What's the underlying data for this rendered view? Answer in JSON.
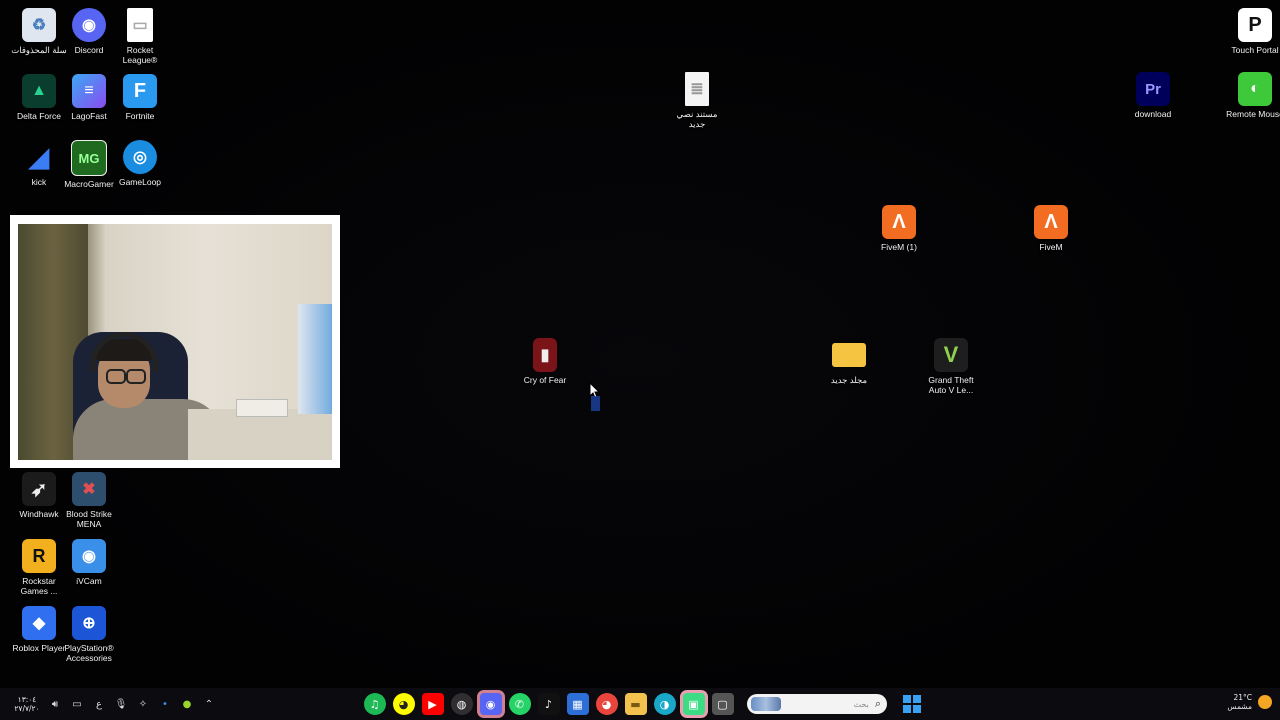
{
  "desktop_icons": [
    {
      "id": "recycle-bin",
      "label": "سلة المحذوفات",
      "color": "#e9eef5"
    },
    {
      "id": "discord",
      "label": "Discord",
      "color": "#5865f2"
    },
    {
      "id": "rocket-league",
      "label": "Rocket League®",
      "color": "#ffffff"
    },
    {
      "id": "touch-portal",
      "label": "Touch Portal",
      "color": "#ffffff"
    },
    {
      "id": "delta-force",
      "label": "Delta Force",
      "color": "#0a7d5a"
    },
    {
      "id": "lagofast",
      "label": "LagoFast",
      "color": "#6a4cf0"
    },
    {
      "id": "fortnite",
      "label": "Fortnite",
      "color": "#2a9af0"
    },
    {
      "id": "new-text-doc",
      "label": "مستند نصي جديد",
      "color": "#f4f4f4"
    },
    {
      "id": "premiere",
      "label": "download",
      "color": "#00005b"
    },
    {
      "id": "remote-mouse",
      "label": "Remote Mouse",
      "color": "#3ec93a"
    },
    {
      "id": "kick",
      "label": "kick",
      "color": "#2a63d6"
    },
    {
      "id": "macrogamer",
      "label": "MacroGamer",
      "color": "#1f6a1f"
    },
    {
      "id": "gameloop",
      "label": "GameLoop",
      "color": "#1a8de0"
    },
    {
      "id": "fivem-1",
      "label": "FiveM (1)",
      "color": "#f26d21"
    },
    {
      "id": "fivem",
      "label": "FiveM",
      "color": "#f26d21"
    },
    {
      "id": "cry-of-fear",
      "label": "Cry of Fear",
      "color": "#7a1418"
    },
    {
      "id": "new-folder",
      "label": "مجلد جديد",
      "color": "#f5c542"
    },
    {
      "id": "gta-v",
      "label": "Grand Theft Auto V Le...",
      "color": "#2f2f2f"
    },
    {
      "id": "windhawk",
      "label": "Windhawk",
      "color": "#1b1b1b"
    },
    {
      "id": "blood-strike",
      "label": "Blood Strike MENA",
      "color": "#2e4e6e"
    },
    {
      "id": "rockstar",
      "label": "Rockstar Games ...",
      "color": "#f2b01e"
    },
    {
      "id": "ivcam",
      "label": "iVCam",
      "color": "#3a8fe8"
    },
    {
      "id": "roblox",
      "label": "Roblox Player",
      "color": "#2f6ff0"
    },
    {
      "id": "ps-accessories",
      "label": "PlayStation® Accessories",
      "color": "#1c56d6"
    }
  ],
  "glyphs": {
    "recycle-bin": "♻",
    "discord": "◉",
    "rocket-league": "▭",
    "touch-portal": "P",
    "delta-force": "▲",
    "lagofast": "≡",
    "fortnite": "F",
    "new-text-doc": "≣",
    "premiere": "Pr",
    "remote-mouse": "◐",
    "kick": "◢",
    "macrogamer": "MG",
    "gameloop": "◎",
    "fivem-1": "Λ",
    "fivem": "Λ",
    "cry-of-fear": "▮",
    "new-folder": "▬",
    "gta-v": "V",
    "windhawk": "➶",
    "blood-strike": "✖",
    "rockstar": "R",
    "ivcam": "◉",
    "roblox": "◆",
    "ps-accessories": "⊕"
  },
  "taskbar": {
    "search_placeholder": "بحث",
    "apps": [
      {
        "id": "spotify",
        "glyph": "♫",
        "color": "#1db954"
      },
      {
        "id": "snapchat",
        "glyph": "◕",
        "color": "#fffc00"
      },
      {
        "id": "youtube",
        "glyph": "▶",
        "color": "#ff0000"
      },
      {
        "id": "obs",
        "glyph": "◍",
        "color": "#302e31"
      },
      {
        "id": "discord",
        "glyph": "◉",
        "color": "#5865f2"
      },
      {
        "id": "whatsapp",
        "glyph": "✆",
        "color": "#25d366"
      },
      {
        "id": "tiktok",
        "glyph": "♪",
        "color": "#111111"
      },
      {
        "id": "store",
        "glyph": "▦",
        "color": "#2d6fd6"
      },
      {
        "id": "chrome",
        "glyph": "◕",
        "color": "#e8453c"
      },
      {
        "id": "file-explorer",
        "glyph": "▬",
        "color": "#f2c14e"
      },
      {
        "id": "edge",
        "glyph": "◑",
        "color": "#1aa8c9"
      },
      {
        "id": "android-studio",
        "glyph": "▣",
        "color": "#3ddc84"
      },
      {
        "id": "task-view",
        "glyph": "▢",
        "color": "#555555"
      }
    ],
    "clock_time": "١٣:٠٤",
    "clock_date": "٢٧/٧/٢٠",
    "weather_temp": "21°C",
    "weather_desc": "مشمس",
    "lang": "ع"
  }
}
